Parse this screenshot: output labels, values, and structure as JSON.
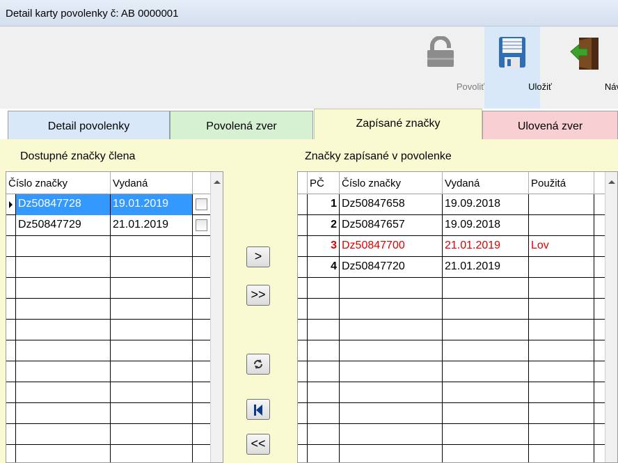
{
  "window": {
    "title": "Detail karty povolenky č: AB 0000001"
  },
  "toolbar": {
    "povolit": {
      "label": "Povoliť",
      "icon": "padlock-icon"
    },
    "ulozit": {
      "label": "Uložiť",
      "icon": "floppy-disk-icon"
    },
    "navrat": {
      "label": "Návrat",
      "icon": "exit-door-icon"
    }
  },
  "tabs": [
    {
      "label": "Detail povolenky",
      "color": "#d8e8f8"
    },
    {
      "label": "Povolená zver",
      "color": "#d6f1d2"
    },
    {
      "label": "Zapísané značky",
      "color": "#fafad2",
      "active": true
    },
    {
      "label": "Ulovená zver",
      "color": "#f8d0d4"
    }
  ],
  "available": {
    "title": "Dostupné značky člena",
    "columns": [
      "Číslo značky",
      "Vydaná"
    ],
    "rows": [
      {
        "cislo": "Dz50847728",
        "vydana": "19.01.2019",
        "checked": false,
        "selected": true
      },
      {
        "cislo": "Dz50847729",
        "vydana": "21.01.2019",
        "checked": false,
        "selected": false
      }
    ]
  },
  "registered": {
    "title": "Značky zapísané v povolenke",
    "columns": [
      "PČ",
      "Číslo značky",
      "Vydaná",
      "Použitá"
    ],
    "rows": [
      {
        "pc": "1",
        "cislo": "Dz50847658",
        "vydana": "19.09.2018",
        "pouzita": ""
      },
      {
        "pc": "2",
        "cislo": "Dz50847657",
        "vydana": "19.09.2018",
        "pouzita": ""
      },
      {
        "pc": "3",
        "cislo": "Dz50847700",
        "vydana": "21.01.2019",
        "pouzita": "Lov",
        "highlight": "#e00000"
      },
      {
        "pc": "4",
        "cislo": "Dz50847720",
        "vydana": "21.01.2019",
        "pouzita": ""
      }
    ]
  },
  "transfer": {
    "move_one": ">",
    "move_all": ">>",
    "refresh_icon": "swap-arrows-icon",
    "first_icon": "skip-to-first-icon",
    "back_all": "<<"
  }
}
